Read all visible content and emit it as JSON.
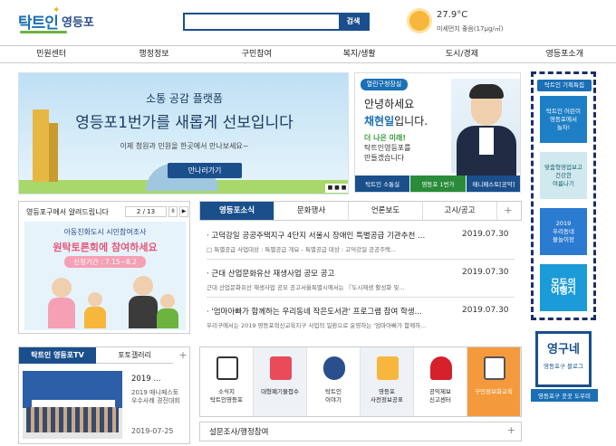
{
  "header": {
    "logo_main": "탁트인",
    "logo_sub": "영등포",
    "search_placeholder": "",
    "search_button": "검색",
    "weather": {
      "temp": "27.9°C",
      "dust": "미세먼지 좋음(17μg/㎥)"
    }
  },
  "nav": [
    "민원센터",
    "행정정보",
    "구민참여",
    "복지/생활",
    "도시/경제",
    "영등포소개"
  ],
  "banner": {
    "subtitle": "소통 공감 플랫폼",
    "title": "영등포1번가를 새롭게 선보입니다",
    "desc": "이제 청원과 민원을 한곳에서 만나보세요~",
    "button": "만나러가기",
    "controls": "■ ■ ■"
  },
  "mayor": {
    "tag": "열린구청장실",
    "hello": "안녕하세요",
    "name_prefix": "채현일",
    "name_suffix": "입니다.",
    "sub_line1": "더 나은 미래!",
    "sub_line2": "탁트인영등포를",
    "sub_line3": "만들겠습니다",
    "tabs": [
      "탁트인 소통실",
      "영등포 1번가",
      "매니페스토[공약]"
    ]
  },
  "notice": {
    "title": "영등포구에서 알려드립니다",
    "page": "2 / 13",
    "pause": "II",
    "next": "▶",
    "line1": "아동친화도시 시민참여조사",
    "line2": "원탁토론회에 참여하세요",
    "line3": "신청기간 : 7.15~8.2"
  },
  "news": {
    "tabs": [
      "영등포소식",
      "문화행사",
      "언론보도",
      "고시/공고"
    ],
    "plus": "+",
    "items": [
      {
        "title": "· 고덕강일 공공주택지구 4단지 서울시 장애인 특별공급 기관추천 ...",
        "date": "2019.07.30",
        "desc": "□ 특별공급 사업대상 : 특별공급 개요 - 특별공급 대상 : 고덕강일 공공주택..."
      },
      {
        "title": "· 근대 산업문화유산 재생사업 공모 공고",
        "date": "2019.07.30",
        "desc": "근대 산업문화유산 재생사업 공모 공고서울특별시에서는 『도시재생 활성화 및..."
      },
      {
        "title": "· '엄마아빠가 함께하는 우리동네 작은도서관' 프로그램 참여 학생...",
        "date": "2019.07.30",
        "desc": "우리구에서는 2019 영등포혁신교육지구 사업의 일환으로 운영하는 '엄마아빠가 함께하..."
      }
    ]
  },
  "rail": {
    "title": "탁트인 기획특집",
    "cards": [
      "탁트인 어린이\n영등포에서\n놀자!",
      "맞춤형영업보고\n건강한\n여름나기",
      "2019\n우리동네\n물놀이장",
      "모두의\n여행지"
    ]
  },
  "tv": {
    "tab1": "탁트인 영등포TV",
    "tab2": "포토갤러리",
    "plus": "+",
    "title": "2019 ...",
    "desc": "2019 매니페스토\n우수사례 경진대회",
    "date": "2019-07-25"
  },
  "quick": [
    {
      "label": "소식지\n탁트인영등포"
    },
    {
      "label": "대형폐기물접수"
    },
    {
      "label": "탁트인\n이야기"
    },
    {
      "label": "영등포\n사전정보공표"
    },
    {
      "label": "공익제보\n신고센터"
    },
    {
      "label": "구민정보화교육"
    }
  ],
  "survey": {
    "title": "설문조사/행정참여",
    "plus": "+"
  },
  "yeongune": {
    "main": "영구네",
    "sub": "영등포구 블로그",
    "caption": "영등포구 꿋꿋 도우미"
  },
  "colors": {
    "primary": "#1a4f8c",
    "accent": "#1a6fb5",
    "orange": "#f59a3c"
  }
}
